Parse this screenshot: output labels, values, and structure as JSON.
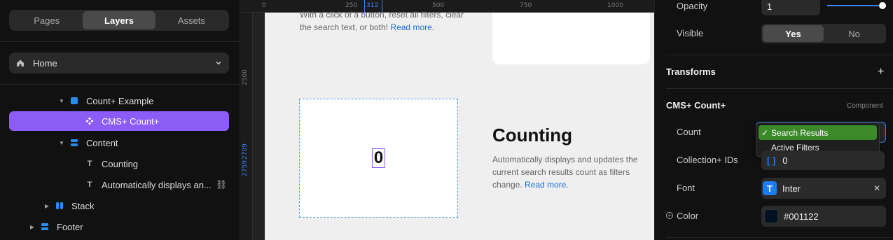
{
  "left_panel": {
    "tabs": [
      {
        "label": "Pages",
        "active": false
      },
      {
        "label": "Layers",
        "active": true
      },
      {
        "label": "Assets",
        "active": false
      }
    ],
    "page_selector": {
      "label": "Home"
    },
    "layers": [
      {
        "label": "Count+ Example",
        "icon": "component-square-icon",
        "expanded": true
      },
      {
        "label": "CMS+ Count+",
        "icon": "component-diamond-icon",
        "selected": true
      },
      {
        "label": "Content",
        "icon": "stack-icon",
        "expanded": true
      },
      {
        "label": "Counting",
        "icon": "text-icon"
      },
      {
        "label": "Automatically displays an...",
        "icon": "text-icon",
        "linked": true
      },
      {
        "label": "Stack",
        "icon": "horizontal-stack-icon",
        "expanded": false
      },
      {
        "label": "Footer",
        "icon": "stack-icon",
        "expanded": false
      }
    ]
  },
  "canvas": {
    "ruler_top": [
      "0",
      "250",
      "312",
      "500",
      "750",
      "1000"
    ],
    "ruler_left": [
      "2500",
      "2709",
      "2759"
    ],
    "top_text": "With a click of a button, reset all filters, clear the search text, or both!",
    "top_link": "Read more.",
    "count_value": "0",
    "section_title": "Counting",
    "section_desc": "Automatically displays and updates the current search results count as filters change.",
    "section_link": "Read more."
  },
  "right_panel": {
    "opacity": {
      "label": "Opacity",
      "value": "1",
      "slider_fraction": 1.0
    },
    "visible": {
      "label": "Visible",
      "yes": "Yes",
      "no": "No",
      "selected": "Yes"
    },
    "transforms": {
      "title": "Transforms"
    },
    "component": {
      "title": "CMS+ Count+",
      "tag": "Component"
    },
    "count": {
      "label": "Count",
      "options": [
        "Search Results",
        "Active Filters"
      ],
      "selected": "Search Results"
    },
    "collection_ids": {
      "label": "Collection+ IDs",
      "value": "0"
    },
    "font": {
      "label": "Font",
      "value": "Inter"
    },
    "color": {
      "label": "Color",
      "value": "#001122"
    }
  },
  "colors": {
    "accent_purple": "#8b5cf6",
    "accent_blue": "#3b82f6",
    "dropdown_selected": "#3a8a2a",
    "link_blue": "#1570d6"
  }
}
